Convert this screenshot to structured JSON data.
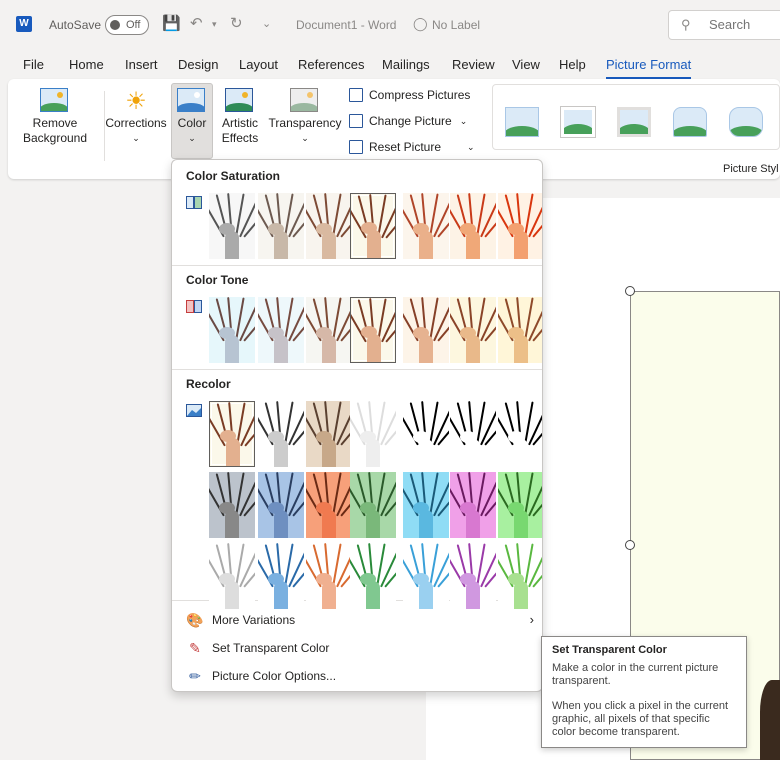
{
  "titlebar": {
    "logo_letter": "W",
    "autosave_label": "AutoSave",
    "autosave_state": "Off",
    "document_title": "Document1  -  Word",
    "sensitivity_label": "No Label",
    "search_placeholder": "Search"
  },
  "tabs": [
    "File",
    "Home",
    "Insert",
    "Design",
    "Layout",
    "References",
    "Mailings",
    "Review",
    "View",
    "Help",
    "Picture Format"
  ],
  "active_tab": "Picture Format",
  "ribbon": {
    "remove_background": [
      "Remove",
      "Background"
    ],
    "corrections": "Corrections",
    "color": "Color",
    "artistic_effects": [
      "Artistic",
      "Effects"
    ],
    "transparency": "Transparency",
    "compress_pictures": "Compress Pictures",
    "change_picture": "Change Picture",
    "reset_picture": "Reset Picture",
    "picture_styles_label": "Picture Styl"
  },
  "dropdown": {
    "color_saturation_title": "Color Saturation",
    "color_tone_title": "Color Tone",
    "recolor_title": "Recolor",
    "more_variations": "More Variations",
    "set_transparent_color": "Set Transparent Color",
    "picture_color_options": "Picture Color Options..."
  },
  "tooltip": {
    "title": "Set Transparent Color",
    "line1": "Make a color in the current picture transparent.",
    "line2": "When you click a pixel in the current graphic, all pixels of that specific color become transparent."
  },
  "colors": {
    "accent": "#185abd",
    "ribbon_bg": "#ffffff",
    "window_bg": "#f3f2f1"
  }
}
